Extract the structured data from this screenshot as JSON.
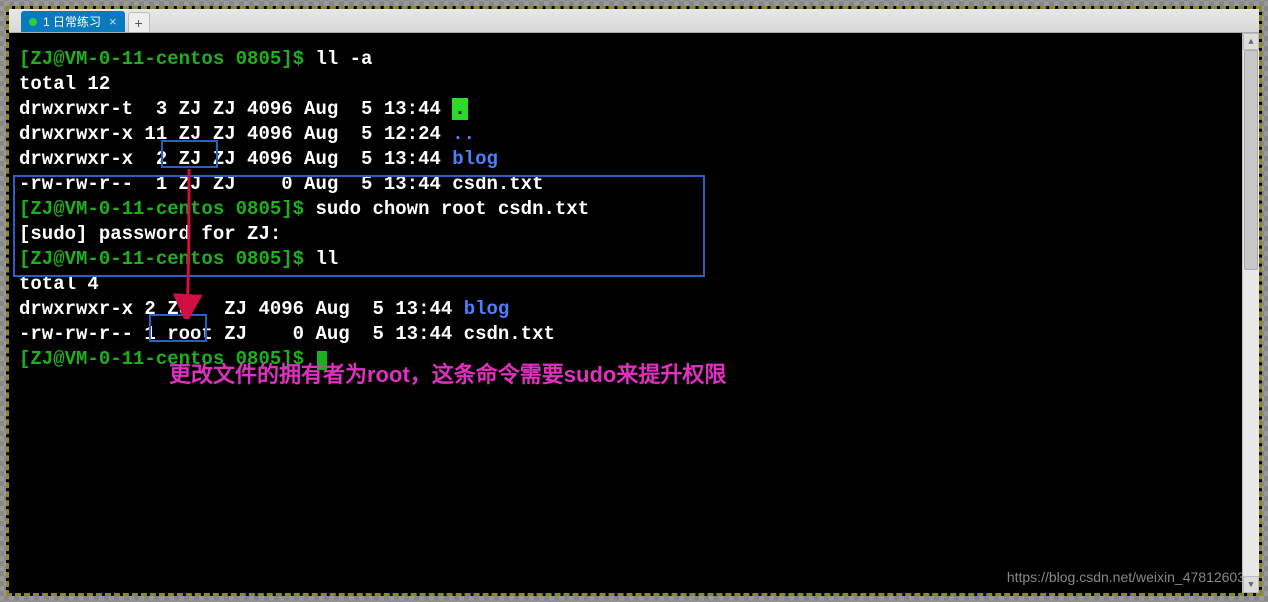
{
  "tab": {
    "title": "1 日常练习",
    "close_glyph": "×",
    "plus_glyph": "+"
  },
  "terminal": {
    "l1_prompt": "[ZJ@VM-0-11-centos 0805]$ ",
    "l1_cmd": "ll -a",
    "l2": "total 12",
    "l3a": "drwxrwxr-t  3 ZJ ZJ 4096 Aug  5 13:44 ",
    "l3b": ".",
    "l4a": "drwxrwxr-x 11 ZJ ZJ 4096 Aug  5 12:24 ",
    "l4b": "..",
    "l5a": "drwxrwxr-x  2 ZJ ZJ 4096 Aug  5 13:44 ",
    "l5b": "blog",
    "l6": "-rw-rw-r--  1 ZJ ZJ    0 Aug  5 13:44 csdn.txt",
    "l7_prompt": "[ZJ@VM-0-11-centos 0805]$ ",
    "l7_cmd": "sudo chown root csdn.txt",
    "l8": "[sudo] password for ZJ:",
    "l9_prompt": "[ZJ@VM-0-11-centos 0805]$ ",
    "l9_cmd": "ll",
    "l10": "total 4",
    "l11a": "drwxrwxr-x 2 ZJ   ZJ 4096 Aug  5 13:44 ",
    "l11b": "blog",
    "l12": "-rw-rw-r-- 1 root ZJ    0 Aug  5 13:44 csdn.txt",
    "l13_prompt": "[ZJ@VM-0-11-centos 0805]$ "
  },
  "annotation": "更改文件的拥有者为root，这条命令需要sudo来提升权限",
  "watermark": "https://blog.csdn.net/weixin_47812603",
  "scrollbar": {
    "up": "▲",
    "down": "▼"
  }
}
